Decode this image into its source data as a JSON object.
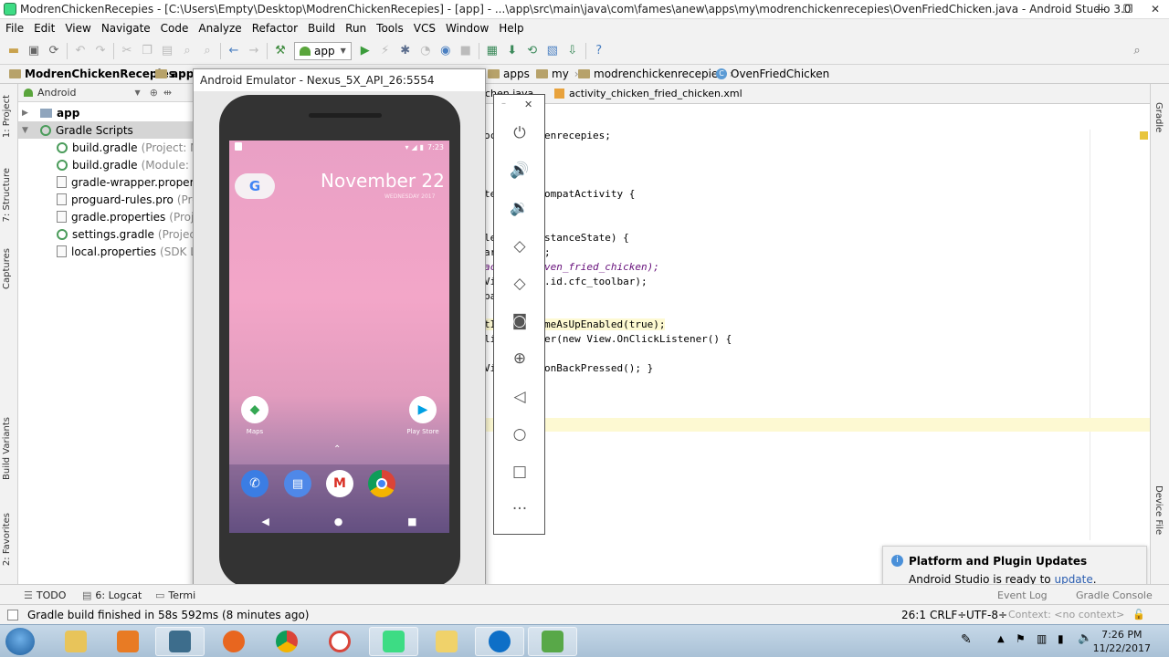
{
  "window": {
    "title": "ModrenChickenRecepies - [C:\\Users\\Empty\\Desktop\\ModrenChickenRecepies] - [app] - ...\\app\\src\\main\\java\\com\\fames\\anew\\apps\\my\\modrenchickenrecepies\\OvenFriedChicken.java - Android Studio 3.0",
    "minimize": "—",
    "maximize": "❐",
    "close": "✕"
  },
  "menu": [
    "File",
    "Edit",
    "View",
    "Navigate",
    "Code",
    "Analyze",
    "Refactor",
    "Build",
    "Run",
    "Tools",
    "VCS",
    "Window",
    "Help"
  ],
  "toolbar": {
    "run_config": "app"
  },
  "breadcrumbs": {
    "project": "ModrenChickenRecepies",
    "module": "app",
    "apps": "apps",
    "my": "my",
    "pkg": "modrenchickenrecepies",
    "class": "OvenFriedChicken"
  },
  "left_tabs": [
    "1: Project",
    "7: Structure",
    "Captures",
    "Build Variants",
    "2: Favorites"
  ],
  "right_tabs": [
    "Gradle",
    "Device File"
  ],
  "project_panel": {
    "view_mode": "Android",
    "tree": [
      {
        "label": "app",
        "hint": ""
      },
      {
        "label": "Gradle Scripts",
        "hint": ""
      },
      {
        "label": "build.gradle",
        "hint": "(Project: Modr"
      },
      {
        "label": "build.gradle",
        "hint": "(Module: app)"
      },
      {
        "label": "gradle-wrapper.properties",
        "hint": ""
      },
      {
        "label": "proguard-rules.pro",
        "hint": "(ProGu"
      },
      {
        "label": "gradle.properties",
        "hint": "(Project P"
      },
      {
        "label": "settings.gradle",
        "hint": "(Project Set"
      },
      {
        "label": "local.properties",
        "hint": "(SDK Locat"
      }
    ]
  },
  "editor": {
    "tabs": [
      "chen.java",
      "activity_chicken_fried_chicken.xml"
    ],
    "code": [
      {
        "a": "oc",
        "b": "enrecepies;"
      },
      {
        "a": "te",
        "b": "ompatActivity {"
      },
      {
        "a": "le",
        "b": "stanceState) {"
      },
      {
        "a": "ar",
        "b": ";"
      },
      {
        "a": "ac",
        "b": "ven_fried_chicken);"
      },
      {
        "a": "Vi",
        "b": ".id.cfc_toolbar);"
      },
      {
        "a": "ba",
        "b": ""
      },
      {
        "a": "tI",
        "b": "meAsUpEnabled(true);"
      },
      {
        "a": "li",
        "b": "er(new View.OnClickListener() {"
      },
      {
        "a": "Vi",
        "b": "onBackPressed(); }"
      }
    ]
  },
  "emulator": {
    "title": "Android Emulator - Nexus_5X_API_26:5554",
    "time": "7:23",
    "date": "November 22",
    "date_sub": "WEDNESDAY 2017",
    "google": "G",
    "apps": [
      {
        "name": "Maps"
      },
      {
        "name": "Play Store"
      }
    ],
    "dock": [
      "phone",
      "messages",
      "gmail",
      "chrome"
    ],
    "controls": [
      "power-icon",
      "volume-up-icon",
      "volume-down-icon",
      "rotate-left-icon",
      "rotate-right-icon",
      "camera-icon",
      "zoom-icon",
      "back-icon",
      "home-icon",
      "overview-icon",
      "more-icon"
    ]
  },
  "bottom_tabs": [
    {
      "label": "TODO"
    },
    {
      "label": "6: Logcat"
    },
    {
      "label": "Termi"
    },
    {
      "label": "Event Log"
    },
    {
      "label": "Gradle Console"
    }
  ],
  "status": {
    "message": "Gradle build finished in 58s 592ms (8 minutes ago)",
    "position": "26:1",
    "line_sep": "CRLF÷",
    "encoding": "UTF-8÷",
    "context": "Context: <no context>"
  },
  "notification": {
    "title": "Platform and Plugin Updates",
    "text": "Android Studio is ready to",
    "link": "update",
    "tail": "."
  },
  "taskbar": {
    "time": "7:26 PM",
    "date": "11/22/2017"
  },
  "colors": {
    "accent": "#3ddc84",
    "link": "#2a5db0"
  }
}
